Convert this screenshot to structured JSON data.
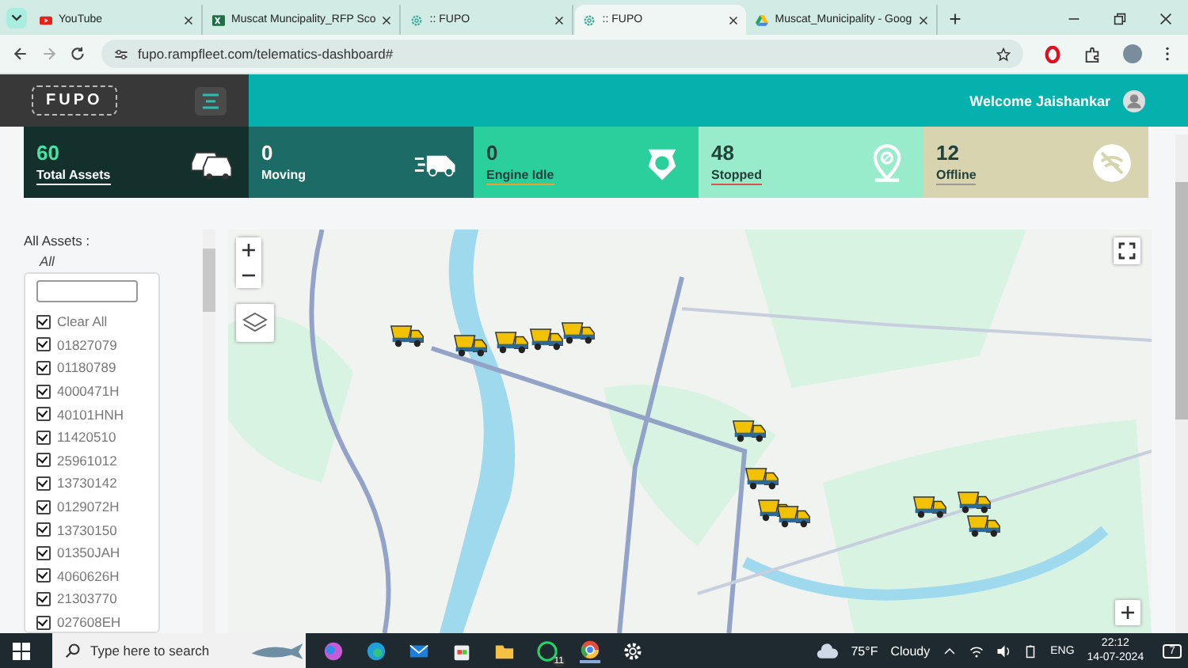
{
  "browser": {
    "tabs": [
      {
        "title": "YouTube",
        "kind": "video",
        "selected": false
      },
      {
        "title": "Muscat Muncipality_RFP Sco",
        "kind": "sheet",
        "selected": false
      },
      {
        "title": ":: FUPO",
        "kind": "app",
        "selected": false
      },
      {
        "title": ":: FUPO",
        "kind": "app",
        "selected": true
      },
      {
        "title": "Muscat_Municipality - Goog",
        "kind": "drive",
        "selected": false
      }
    ],
    "url": "fupo.rampfleet.com/telematics-dashboard#"
  },
  "header": {
    "logo": "FUPO",
    "welcome": "Welcome Jaishankar"
  },
  "stats": [
    {
      "value": "60",
      "label": "Total Assets",
      "color": "#14302c",
      "kind": "total"
    },
    {
      "value": "0",
      "label": "Moving",
      "color": "#1d6b66",
      "kind": "moving"
    },
    {
      "value": "0",
      "label": "Engine Idle",
      "color": "#2bcf9c",
      "kind": "idle"
    },
    {
      "value": "48",
      "label": "Stopped",
      "color": "#98eccb",
      "kind": "stopped"
    },
    {
      "value": "12",
      "label": "Offline",
      "color": "#d8d4b0",
      "kind": "offline"
    }
  ],
  "filter": {
    "label": "All Assets :",
    "selection": "All",
    "items": [
      {
        "label": "Clear All",
        "checked": true
      },
      {
        "label": "01827079",
        "checked": true
      },
      {
        "label": "01180789",
        "checked": true
      },
      {
        "label": "4000471H",
        "checked": true
      },
      {
        "label": "40101HNH",
        "checked": true
      },
      {
        "label": "11420510",
        "checked": true
      },
      {
        "label": "25961012",
        "checked": true
      },
      {
        "label": "13730142",
        "checked": true
      },
      {
        "label": "0129072H",
        "checked": true
      },
      {
        "label": "13730150",
        "checked": true
      },
      {
        "label": "01350JAH",
        "checked": true
      },
      {
        "label": "4060626H",
        "checked": true
      },
      {
        "label": "21303770",
        "checked": true
      },
      {
        "label": "027608EH",
        "checked": true
      }
    ]
  },
  "taskbar": {
    "search_placeholder": "Type here to search",
    "whatsapp_badge": "11",
    "temperature": "75°F",
    "weather": "Cloudy",
    "language": "ENG",
    "time": "22:12",
    "date": "14-07-2024",
    "notifications": "7"
  }
}
